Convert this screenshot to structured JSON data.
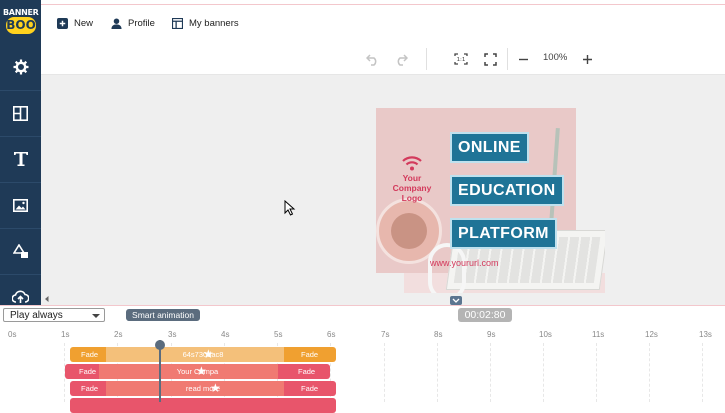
{
  "app": {
    "logo_top": "BANNER",
    "logo_bottom": "BOO"
  },
  "topnav": [
    {
      "label": "New",
      "icon": "plus-square-icon"
    },
    {
      "label": "Profile",
      "icon": "user-icon"
    },
    {
      "label": "My banners",
      "icon": "layout-icon"
    }
  ],
  "sidebar": {
    "items": [
      {
        "name": "settings",
        "icon": "gear-icon"
      },
      {
        "name": "layouts",
        "icon": "grid-icon"
      },
      {
        "name": "text",
        "icon": "text-icon"
      },
      {
        "name": "images",
        "icon": "image-icon"
      },
      {
        "name": "shapes",
        "icon": "shapes-icon"
      },
      {
        "name": "upload",
        "icon": "cloud-upload-icon"
      }
    ]
  },
  "toolbar": {
    "zoom": "100%"
  },
  "banner": {
    "logo_line1": "Your",
    "logo_line2": "Company",
    "logo_line3": "Logo",
    "headline1": "ONLINE",
    "headline2": "EDUCATION",
    "headline3": "PLATFORM",
    "url": "www.yoururl.com",
    "colors": {
      "box": "#1f7497",
      "accent": "#d33a5c"
    }
  },
  "timeline": {
    "play_mode": "Play always",
    "smart_button": "Smart animation",
    "time": "00:02:80",
    "ticks": [
      "0s",
      "1s",
      "2s",
      "3s",
      "4s",
      "5s",
      "6s",
      "7s",
      "8s",
      "9s",
      "10s",
      "11s",
      "12s",
      "13s"
    ],
    "tracks": [
      {
        "in": "Fade",
        "label": "64s730dac8",
        "out": "Fade",
        "color": "#f0a030"
      },
      {
        "in": "Fade",
        "label": "Your Compa",
        "out": "Fade",
        "color": "#e8556b"
      },
      {
        "in": "Fade",
        "label": "read more",
        "out": "Fade",
        "color": "#e8556b"
      }
    ]
  }
}
